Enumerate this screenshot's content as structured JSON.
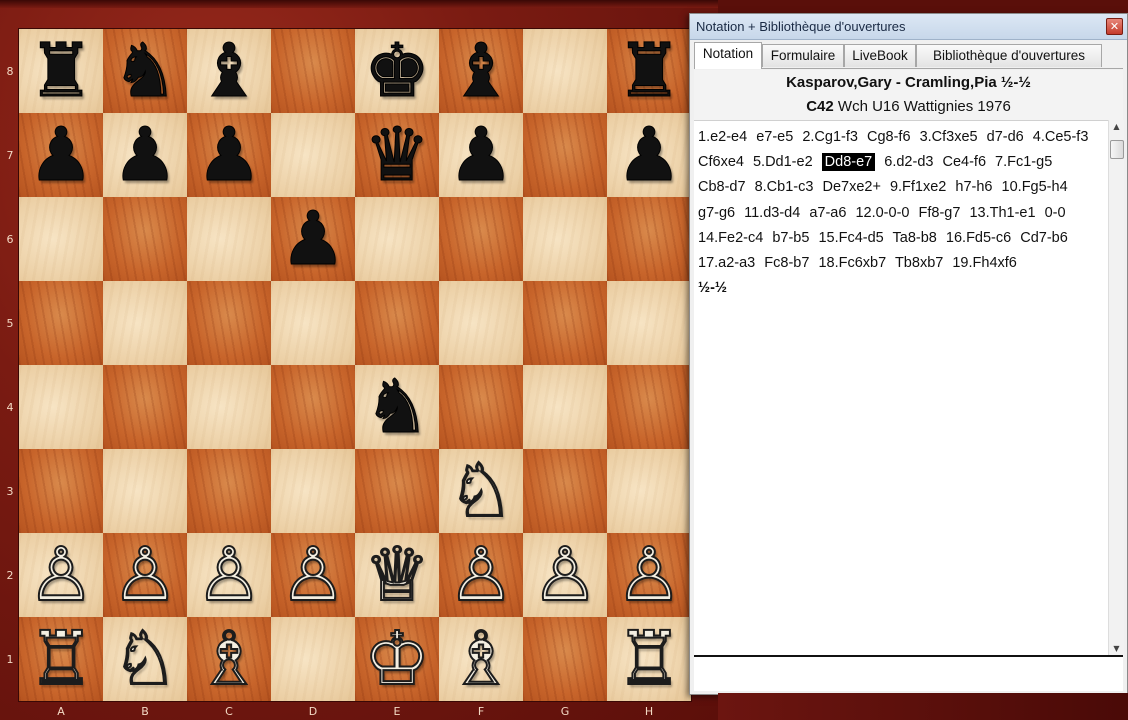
{
  "board": {
    "files": [
      "A",
      "B",
      "C",
      "D",
      "E",
      "F",
      "G",
      "H"
    ],
    "ranks": [
      "8",
      "7",
      "6",
      "5",
      "4",
      "3",
      "2",
      "1"
    ],
    "position": [
      [
        "br",
        "bn",
        "bb",
        "",
        "bk",
        "bb",
        "",
        "br"
      ],
      [
        "bp",
        "bp",
        "bp",
        "",
        "bq",
        "bp",
        "",
        "bp"
      ],
      [
        "",
        "",
        "",
        "bp",
        "",
        "",
        "",
        ""
      ],
      [
        "",
        "",
        "",
        "",
        "",
        "",
        "",
        ""
      ],
      [
        "",
        "",
        "",
        "",
        "bn",
        "",
        "",
        ""
      ],
      [
        "",
        "",
        "",
        "",
        "",
        "wn",
        "",
        ""
      ],
      [
        "wp",
        "wp",
        "wp",
        "wp",
        "wq",
        "wp",
        "wp",
        "wp"
      ],
      [
        "wr",
        "wn",
        "wb",
        "",
        "wk",
        "wb",
        "",
        "wr"
      ]
    ],
    "glyphs": {
      "wk": "♔",
      "wq": "♕",
      "wr": "♖",
      "wb": "♗",
      "wn": "♘",
      "wp": "♙",
      "bk": "♚",
      "bq": "♛",
      "br": "♜",
      "bb": "♝",
      "bn": "♞",
      "bp": "♟"
    }
  },
  "panel": {
    "title": "Notation + Bibliothèque d'ouvertures",
    "close_glyph": "✕",
    "tabs": [
      {
        "label": "Notation",
        "active": true
      },
      {
        "label": "Formulaire",
        "active": false
      },
      {
        "label": "LiveBook",
        "active": false
      },
      {
        "label": "Bibliothèque d'ouvertures",
        "active": false
      }
    ],
    "game": {
      "players": "Kasparov,Gary - Cramling,Pia  ½-½",
      "eco": "C42",
      "event": "Wch U16 Wattignies 1976"
    },
    "moves": [
      "1.e2-e4",
      "e7-e5",
      "2.Cg1-f3",
      "Cg8-f6",
      "3.Cf3xe5",
      "d7-d6",
      "4.Ce5-f3",
      "Cf6xe4",
      "5.Dd1-e2",
      "Dd8-e7",
      "6.d2-d3",
      "Ce4-f6",
      "7.Fc1-g5",
      "Cb8-d7",
      "8.Cb1-c3",
      "De7xe2+",
      "9.Ff1xe2",
      "h7-h6",
      "10.Fg5-h4",
      "g7-g6",
      "11.d3-d4",
      "a7-a6",
      "12.0-0-0",
      "Ff8-g7",
      "13.Th1-e1",
      "0-0",
      "14.Fe2-c4",
      "b7-b5",
      "15.Fc4-d5",
      "Ta8-b8",
      "16.Fd5-c6",
      "Cd7-b6",
      "17.a2-a3",
      "Fc8-b7",
      "18.Fc6xb7",
      "Tb8xb7",
      "19.Fh4xf6"
    ],
    "highlighted_move_index": 9,
    "result": "½-½"
  }
}
